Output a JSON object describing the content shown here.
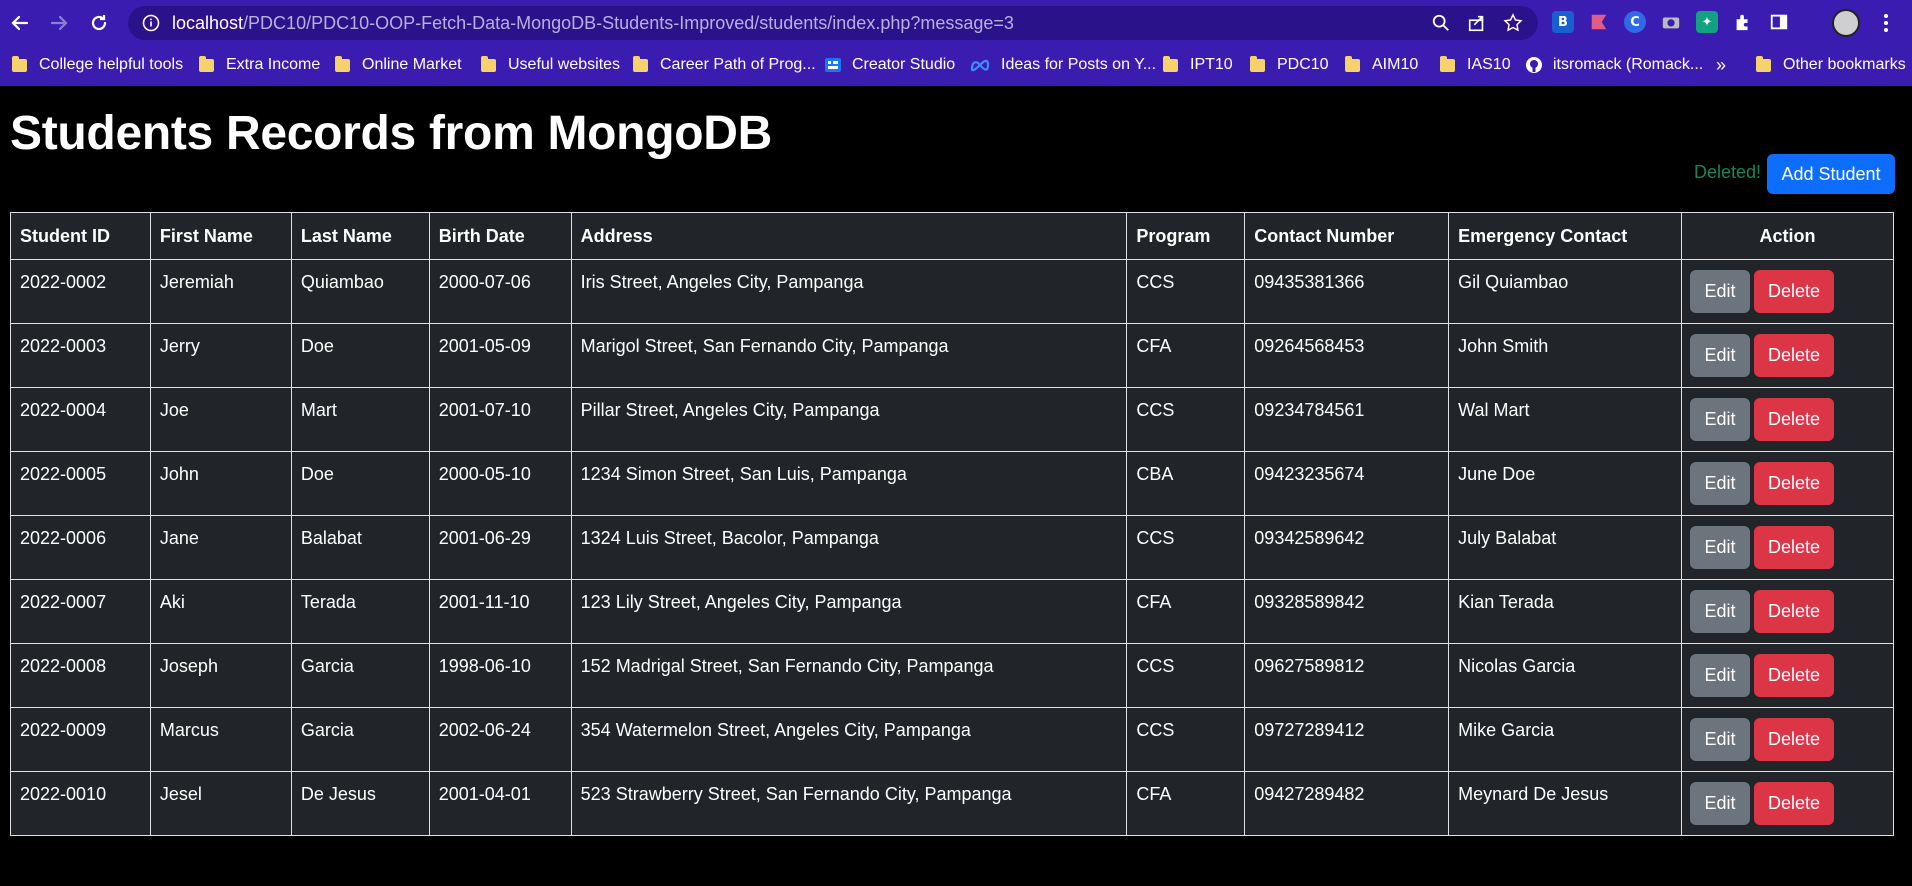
{
  "browser": {
    "url_host": "localhost",
    "url_path": "/PDC10/PDC10-OOP-Fetch-Data-MongoDB-Students-Improved/students/index.php?message=3",
    "bookmarks": [
      {
        "label": "College helpful tools",
        "icon": "folder-icon"
      },
      {
        "label": "Extra Income",
        "icon": "folder-icon"
      },
      {
        "label": "Online Market",
        "icon": "folder-icon"
      },
      {
        "label": "Useful websites",
        "icon": "folder-icon"
      },
      {
        "label": "Career Path of Prog...",
        "icon": "folder-icon"
      },
      {
        "label": "Creator Studio",
        "icon": "creator-studio-icon"
      },
      {
        "label": "Ideas for Posts on Y...",
        "icon": "meta-icon"
      },
      {
        "label": "IPT10",
        "icon": "folder-icon"
      },
      {
        "label": "PDC10",
        "icon": "folder-icon"
      },
      {
        "label": "AIM10",
        "icon": "folder-icon"
      },
      {
        "label": "IAS10",
        "icon": "folder-icon"
      },
      {
        "label": "itsromack (Romack...",
        "icon": "github-icon"
      },
      {
        "label": "»",
        "icon": "overflow-icon"
      },
      {
        "label": "Other bookmarks",
        "icon": "folder-icon"
      }
    ]
  },
  "page": {
    "title": "Students Records from MongoDB",
    "flash_message": "Deleted!",
    "add_button": "Add Student"
  },
  "table": {
    "headers": [
      "Student ID",
      "First Name",
      "Last Name",
      "Birth Date",
      "Address",
      "Program",
      "Contact Number",
      "Emergency Contact",
      "Action"
    ],
    "rows": [
      [
        "2022-0002",
        "Jeremiah",
        "Quiambao",
        "2000-07-06",
        "Iris Street, Angeles City, Pampanga",
        "CCS",
        "09435381366",
        "Gil Quiambao"
      ],
      [
        "2022-0003",
        "Jerry",
        "Doe",
        "2001-05-09",
        "Marigol Street, San Fernando City, Pampanga",
        "CFA",
        "09264568453",
        "John Smith"
      ],
      [
        "2022-0004",
        "Joe",
        "Mart",
        "2001-07-10",
        "Pillar Street, Angeles City, Pampanga",
        "CCS",
        "09234784561",
        "Wal Mart"
      ],
      [
        "2022-0005",
        "John",
        "Doe",
        "2000-05-10",
        "1234 Simon Street, San Luis, Pampanga",
        "CBA",
        "09423235674",
        "June Doe"
      ],
      [
        "2022-0006",
        "Jane",
        "Balabat",
        "2001-06-29",
        "1324 Luis Street, Bacolor, Pampanga",
        "CCS",
        "09342589642",
        "July Balabat"
      ],
      [
        "2022-0007",
        "Aki",
        "Terada",
        "2001-11-10",
        "123 Lily Street, Angeles City, Pampanga",
        "CFA",
        "09328589842",
        "Kian Terada"
      ],
      [
        "2022-0008",
        "Joseph",
        "Garcia",
        "1998-06-10",
        "152 Madrigal Street, San Fernando City, Pampanga",
        "CCS",
        "09627589812",
        "Nicolas Garcia"
      ],
      [
        "2022-0009",
        "Marcus",
        "Garcia",
        "2002-06-24",
        "354 Watermelon Street, Angeles City, Pampanga",
        "CCS",
        "09727289412",
        "Mike Garcia"
      ],
      [
        "2022-0010",
        "Jesel",
        "De Jesus",
        "2001-04-01",
        "523 Strawberry Street, San Fernando City, Pampanga",
        "CFA",
        "09427289482",
        "Meynard De Jesus"
      ]
    ],
    "edit_label": "Edit",
    "delete_label": "Delete"
  },
  "colors": {
    "chrome_bg": "#3a1db0",
    "table_bg": "#212529",
    "primary": "#0d6efd",
    "secondary": "#6c757d",
    "danger": "#dc3545",
    "success": "#198754"
  }
}
